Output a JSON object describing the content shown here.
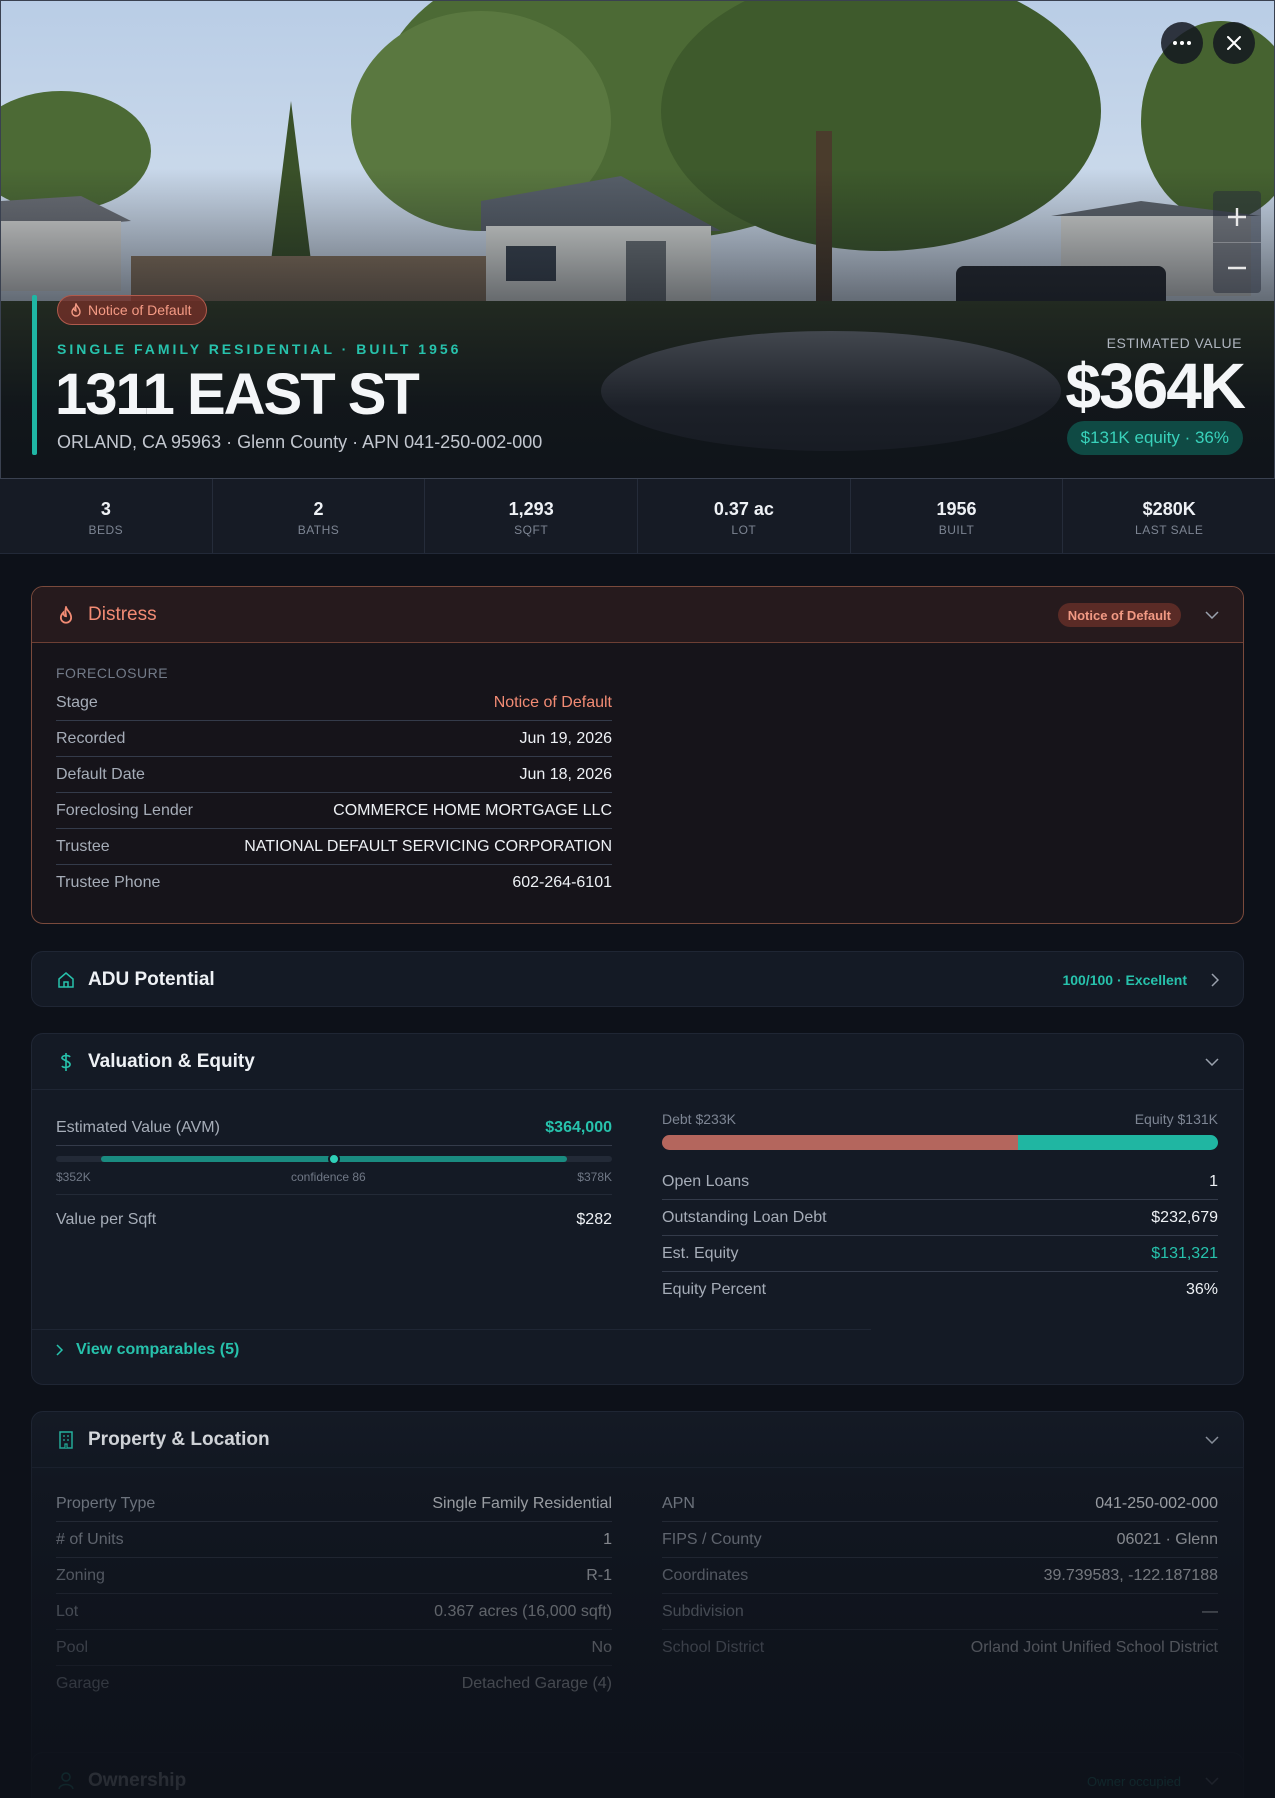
{
  "hero": {
    "distress_badge": "Notice of Default",
    "property_type_line": "SINGLE FAMILY RESIDENTIAL · BUILT 1956",
    "address": "1311 EAST ST",
    "subline": "ORLAND, CA 95963 · Glenn County · APN 041-250-002-000",
    "estimated_value_label": "ESTIMATED VALUE",
    "estimated_value": "$364K",
    "equity_badge": "$131K equity · 36%",
    "icons": {
      "more": "more-horizontal-icon",
      "close": "close-icon",
      "zoom_in": "plus-icon",
      "zoom_out": "minus-icon",
      "flame": "flame-icon"
    }
  },
  "stats": [
    {
      "value": "3",
      "label": "BEDS"
    },
    {
      "value": "2",
      "label": "BATHS"
    },
    {
      "value": "1,293",
      "label": "SQFT"
    },
    {
      "value": "0.37 ac",
      "label": "LOT"
    },
    {
      "value": "1956",
      "label": "BUILT"
    },
    {
      "value": "$280K",
      "label": "LAST SALE"
    }
  ],
  "distress": {
    "title": "Distress",
    "badge": "Notice of Default",
    "section_label": "FORECLOSURE",
    "rows": [
      {
        "k": "Stage",
        "v": "Notice of Default"
      },
      {
        "k": "Recorded",
        "v": "Jun 19, 2026"
      },
      {
        "k": "Default Date",
        "v": "Jun 18, 2026"
      },
      {
        "k": "Foreclosing Lender",
        "v": "COMMERCE HOME MORTGAGE LLC"
      },
      {
        "k": "Trustee",
        "v": "NATIONAL DEFAULT SERVICING CORPORATION"
      },
      {
        "k": "Trustee Phone",
        "v": "602-264-6101"
      }
    ]
  },
  "adu": {
    "title": "ADU Potential",
    "score": "100/100 · Excellent"
  },
  "valuation": {
    "title": "Valuation & Equity",
    "avm_label": "Estimated Value (AVM)",
    "avm_value": "$364,000",
    "range_low": "$352K",
    "confidence": "confidence 86",
    "range_high": "$378K",
    "value_per_sqft_label": "Value per Sqft",
    "value_per_sqft": "$282",
    "debt_label": "Debt $233K",
    "equity_label": "Equity $131K",
    "debt_fraction": 0.64,
    "rows": [
      {
        "k": "Open Loans",
        "v": "1"
      },
      {
        "k": "Outstanding Loan Debt",
        "v": "$232,679"
      },
      {
        "k": "Est. Equity",
        "v": "$131,321"
      },
      {
        "k": "Equity Percent",
        "v": "36%"
      }
    ],
    "comps_link": "View comparables (5)"
  },
  "property": {
    "title": "Property & Location",
    "left": [
      {
        "k": "Property Type",
        "v": "Single Family Residential"
      },
      {
        "k": "# of Units",
        "v": "1"
      },
      {
        "k": "Zoning",
        "v": "R-1"
      },
      {
        "k": "Lot",
        "v": "0.367 acres (16,000 sqft)"
      },
      {
        "k": "Pool",
        "v": "No"
      },
      {
        "k": "Garage",
        "v": "Detached Garage (4)"
      }
    ],
    "right": [
      {
        "k": "APN",
        "v": "041-250-002-000"
      },
      {
        "k": "FIPS / County",
        "v": "06021 · Glenn"
      },
      {
        "k": "Coordinates",
        "v": "39.739583, -122.187188"
      },
      {
        "k": "Subdivision",
        "v": "—"
      },
      {
        "k": "School District",
        "v": "Orland Joint Unified School District"
      }
    ]
  },
  "ownership": {
    "title": "Ownership",
    "badge": "Owner occupied"
  },
  "colors": {
    "accent": "#1fb6a4",
    "distress": "#f28b74",
    "background": "#0d1119",
    "card": "#141a25"
  }
}
